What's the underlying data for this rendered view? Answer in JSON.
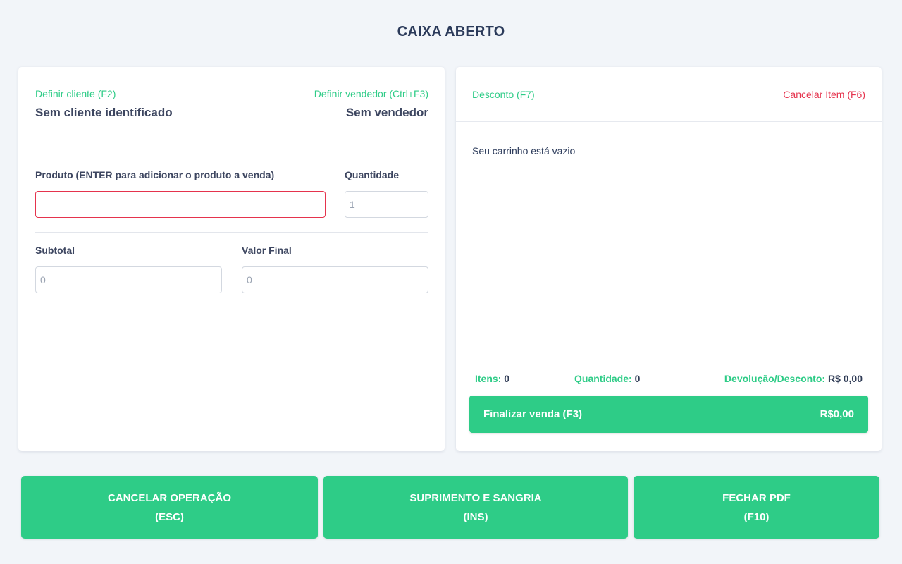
{
  "page": {
    "title": "CAIXA ABERTO"
  },
  "left_panel": {
    "client": {
      "link": "Definir cliente (F2)",
      "value": "Sem cliente identificado"
    },
    "seller": {
      "link": "Definir vendedor (Ctrl+F3)",
      "value": "Sem vendedor"
    },
    "product": {
      "label": "Produto (ENTER para adicionar o produto a venda)",
      "value": ""
    },
    "quantity": {
      "label": "Quantidade",
      "value": "1"
    },
    "subtotal": {
      "label": "Subtotal",
      "value": "0"
    },
    "final_value": {
      "label": "Valor Final",
      "value": "0"
    }
  },
  "right_panel": {
    "discount_link": "Desconto (F7)",
    "cancel_item_link": "Cancelar Item (F6)",
    "empty_message": "Seu carrinho está vazio",
    "stats": {
      "items_label": "Itens:",
      "items_value": "0",
      "quantity_label": "Quantidade:",
      "quantity_value": "0",
      "discount_label": "Devolução/Desconto:",
      "discount_value": "R$ 0,00"
    },
    "finish": {
      "label": "Finalizar venda (F3)",
      "amount": "R$0,00"
    }
  },
  "actions": {
    "cancel": {
      "line1": "CANCELAR OPERAÇÃO",
      "line2": "(ESC)"
    },
    "supply": {
      "line1": "SUPRIMENTO E SANGRIA",
      "line2": "(INS)"
    },
    "pdf": {
      "line1": "FECHAR PDF",
      "line2": "(F10)"
    }
  },
  "colors": {
    "accent": "#2ecc87",
    "danger": "#e5334d",
    "text": "#2f3b55",
    "background": "#f2f5f9"
  }
}
